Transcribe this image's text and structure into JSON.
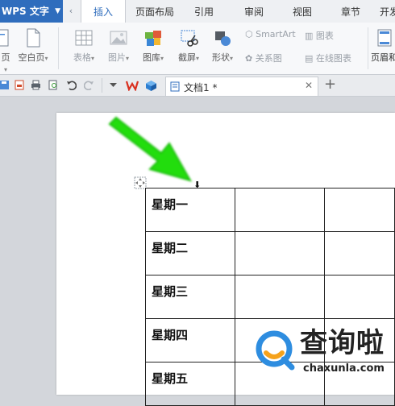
{
  "app": {
    "title": "WPS 文字"
  },
  "tabs": [
    {
      "label": "插入",
      "active": true
    },
    {
      "label": "页面布局",
      "active": false
    },
    {
      "label": "引用",
      "active": false
    },
    {
      "label": "审阅",
      "active": false
    },
    {
      "label": "视图",
      "active": false
    },
    {
      "label": "章节",
      "active": false
    },
    {
      "label": "开发",
      "active": false
    }
  ],
  "ribbon": {
    "page_label": "页",
    "blank_page_label": "空白页",
    "table_label": "表格",
    "picture_label": "图片",
    "gallery_label": "图库",
    "screenshot_label": "截屏",
    "shape_label": "形状",
    "smartart_label": "SmartArt",
    "relation_label": "关系图",
    "chart_label": "图表",
    "online_chart_label": "在线图表",
    "header_footer_label": "页眉和"
  },
  "document": {
    "tab_name": "文档1 *",
    "close_symbol": "✕",
    "new_tab_symbol": "+",
    "marker_symbol": "⬇"
  },
  "table": {
    "days": [
      "星期一",
      "星期二",
      "星期三",
      "星期四",
      "星期五"
    ]
  },
  "watermark": {
    "title": "查询啦",
    "url": "chaxunla.com"
  },
  "colors": {
    "accent": "#2f6dbd",
    "arrow": "#22dd11",
    "watermark_blue": "#2e8de0",
    "watermark_orange": "#f5a21b"
  }
}
